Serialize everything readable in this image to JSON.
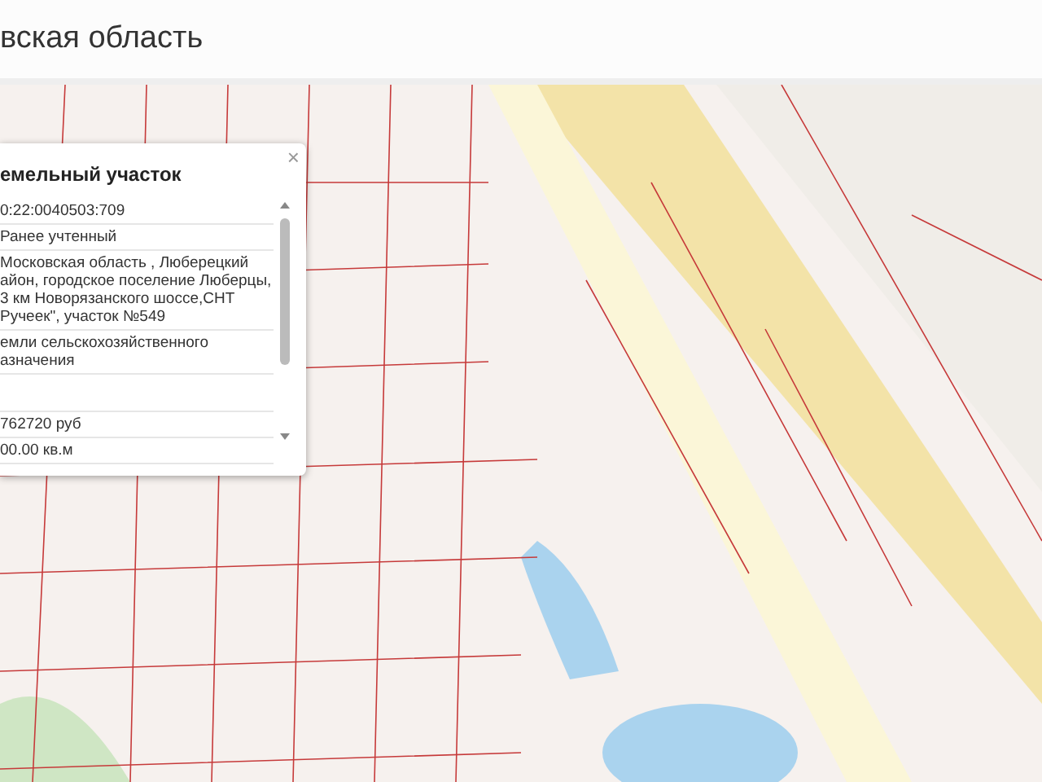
{
  "header": {
    "title": "вская область"
  },
  "popup": {
    "close": "×",
    "title": "емельный участок",
    "rows": [
      {
        "lines": [
          "0:22:0040503:709"
        ]
      },
      {
        "lines": [
          "Ранее учтенный"
        ]
      },
      {
        "lines": [
          "Московская область , Люберецкий",
          "айон, городское поселение Люберцы,",
          "3 км Новорязанского шоссе,СНТ",
          "Ручеек\", участок №549"
        ]
      },
      {
        "lines": [
          "емли сельскохозяйственного",
          "азначения"
        ]
      },
      {
        "lines": [
          "762720 руб"
        ],
        "gap_before": true
      },
      {
        "lines": [
          "00.00 кв.м"
        ]
      }
    ]
  }
}
